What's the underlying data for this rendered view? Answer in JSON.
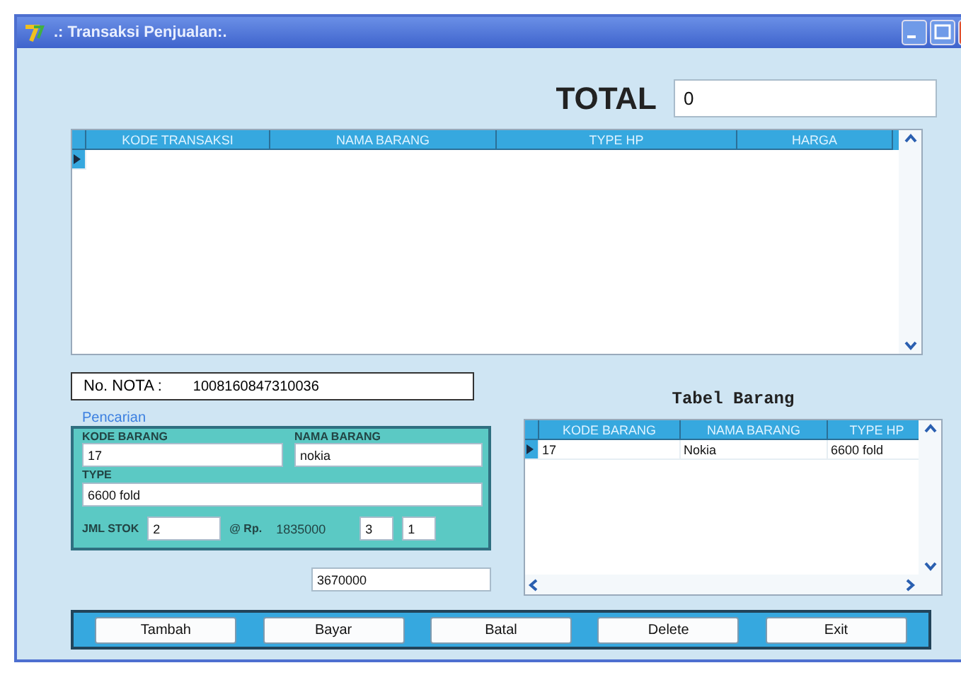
{
  "window": {
    "title": ".: Transaksi Penjualan:."
  },
  "total": {
    "label": "TOTAL",
    "value": "0"
  },
  "transaction_table": {
    "columns": [
      "KODE TRANSAKSI",
      "NAMA BARANG",
      "TYPE HP",
      "HARGA"
    ]
  },
  "nota": {
    "label": "No. NOTA :",
    "value": "1008160847310036"
  },
  "search": {
    "title": "Pencarian",
    "kode_barang": {
      "label": "KODE BARANG",
      "value": "17"
    },
    "nama_barang": {
      "label": "NAMA BARANG",
      "value": "nokia"
    },
    "type": {
      "label": "TYPE",
      "value": "6600 fold"
    },
    "jml_stok": {
      "label": "JML STOK",
      "value": "2"
    },
    "price_label": "@ Rp.",
    "price": "1835000",
    "field_3": "3",
    "field_4": "1"
  },
  "subtotal": "3670000",
  "item_table": {
    "title": "Tabel Barang",
    "columns": [
      "KODE BARANG",
      "NAMA BARANG",
      "TYPE HP"
    ],
    "rows": [
      [
        "17",
        "Nokia",
        "6600 fold"
      ]
    ]
  },
  "buttons": [
    "Tambah",
    "Bayar",
    "Batal",
    "Delete",
    "Exit"
  ]
}
